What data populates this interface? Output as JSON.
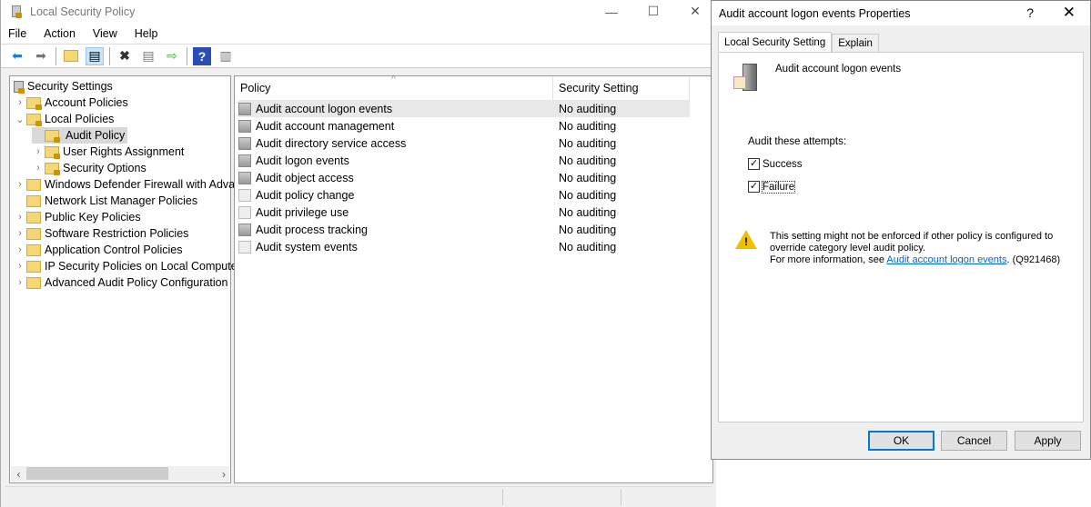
{
  "window": {
    "title": "Local Security Policy",
    "minimize": "—",
    "maximize": "☐",
    "close": "✕"
  },
  "menu": [
    "File",
    "Action",
    "View",
    "Help"
  ],
  "toolbar": [
    "back-icon",
    "forward-icon",
    "up-folder-icon",
    "show-hide-tree-icon",
    "delete-icon",
    "properties-icon",
    "export-list-icon",
    "help-icon",
    "show-action-pane-icon"
  ],
  "tree": [
    {
      "label": "Security Settings",
      "level": 0,
      "chev": ""
    },
    {
      "label": "Account Policies",
      "level": 1,
      "chev": "›"
    },
    {
      "label": "Local Policies",
      "level": 1,
      "chev": "⌄"
    },
    {
      "label": "Audit Policy",
      "level": 2,
      "chev": "",
      "selected": true
    },
    {
      "label": "User Rights Assignment",
      "level": 2,
      "chev": "›"
    },
    {
      "label": "Security Options",
      "level": 2,
      "chev": "›"
    },
    {
      "label": "Windows Defender Firewall with Adva",
      "level": 1,
      "chev": "›"
    },
    {
      "label": "Network List Manager Policies",
      "level": 1,
      "chev": ""
    },
    {
      "label": "Public Key Policies",
      "level": 1,
      "chev": "›"
    },
    {
      "label": "Software Restriction Policies",
      "level": 1,
      "chev": "›"
    },
    {
      "label": "Application Control Policies",
      "level": 1,
      "chev": "›"
    },
    {
      "label": "IP Security Policies on Local Compute",
      "level": 1,
      "chev": "›"
    },
    {
      "label": "Advanced Audit Policy Configuration",
      "level": 1,
      "chev": "›"
    }
  ],
  "list": {
    "columns": [
      "Policy",
      "Security Setting"
    ],
    "rows": [
      [
        "Audit account logon events",
        "No auditing"
      ],
      [
        "Audit account management",
        "No auditing"
      ],
      [
        "Audit directory service access",
        "No auditing"
      ],
      [
        "Audit logon events",
        "No auditing"
      ],
      [
        "Audit object access",
        "No auditing"
      ],
      [
        "Audit policy change",
        "No auditing"
      ],
      [
        "Audit privilege use",
        "No auditing"
      ],
      [
        "Audit process tracking",
        "No auditing"
      ],
      [
        "Audit system events",
        "No auditing"
      ]
    ]
  },
  "dialog": {
    "title": "Audit account logon events Properties",
    "help": "?",
    "close": "✕",
    "tabs": [
      "Local Security Setting",
      "Explain"
    ],
    "policy_name": "Audit account logon events",
    "attempts_label": "Audit these attempts:",
    "success": {
      "label": "Success",
      "checked": true
    },
    "failure": {
      "label": "Failure",
      "checked": true
    },
    "warning_line1": "This setting might not be enforced if other policy is configured to",
    "warning_line2": "override category level audit policy.",
    "more_info_prefix": "For more information, see ",
    "more_info_link": "Audit account logon events",
    "more_info_suffix": ". (Q921468)",
    "ok": "OK",
    "cancel": "Cancel",
    "apply": "Apply"
  }
}
